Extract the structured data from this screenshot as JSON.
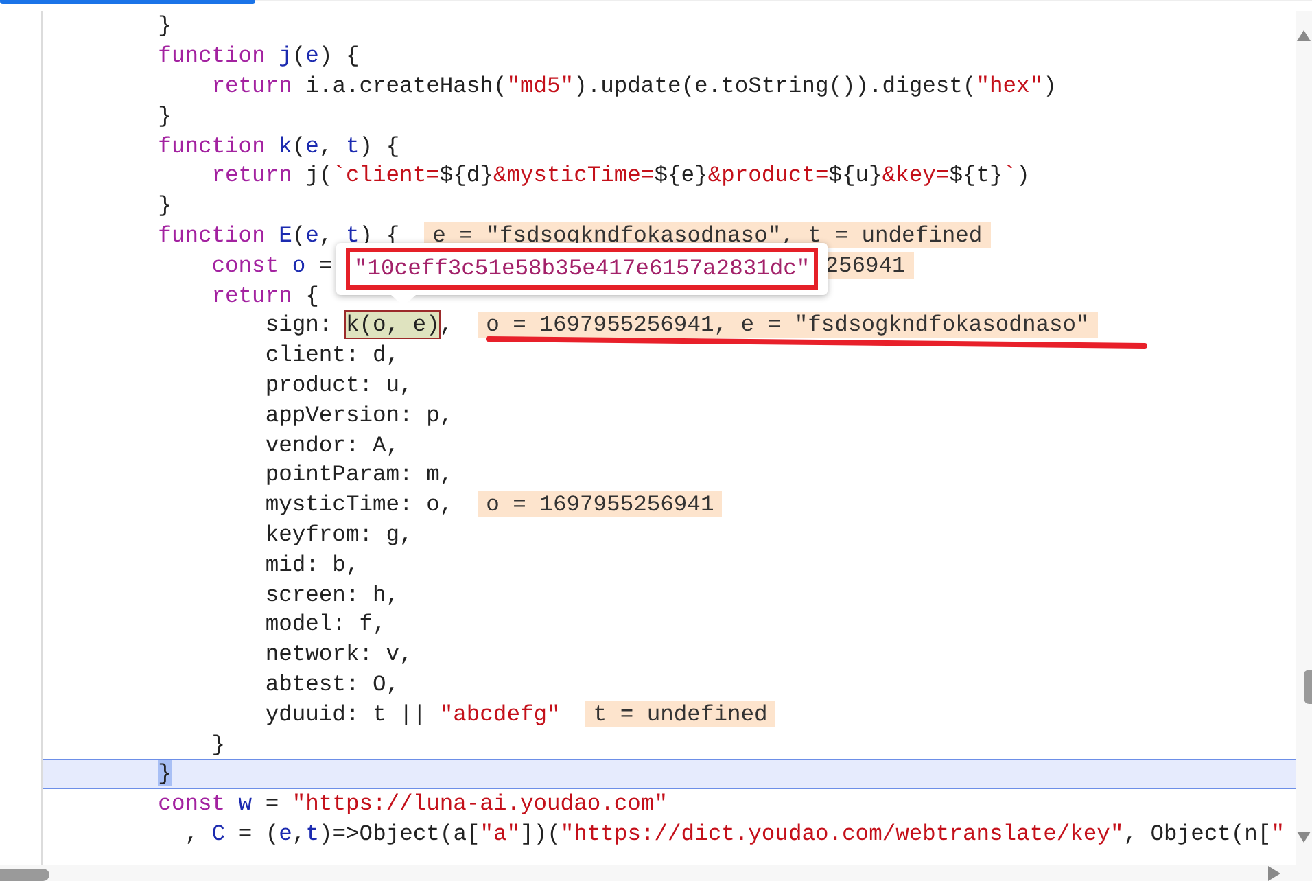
{
  "editor": {
    "lines": [
      {
        "selected": false,
        "underlined": false,
        "tokens": [
          {
            "text": "        }",
            "kind": "plain"
          }
        ]
      },
      {
        "selected": false,
        "underlined": false,
        "tokens": [
          {
            "text": "        function ",
            "kind": "keyword"
          },
          {
            "text": "j",
            "kind": "def"
          },
          {
            "text": "(",
            "kind": "plain"
          },
          {
            "text": "e",
            "kind": "def"
          },
          {
            "text": ") {",
            "kind": "plain"
          }
        ]
      },
      {
        "selected": false,
        "underlined": false,
        "tokens": [
          {
            "text": "            return ",
            "kind": "keyword"
          },
          {
            "text": "i.a.createHash(",
            "kind": "plain"
          },
          {
            "text": "\"md5\"",
            "kind": "string"
          },
          {
            "text": ").update(e.toString()).digest(",
            "kind": "plain"
          },
          {
            "text": "\"hex\"",
            "kind": "string"
          },
          {
            "text": ")",
            "kind": "plain"
          }
        ]
      },
      {
        "selected": false,
        "underlined": false,
        "tokens": [
          {
            "text": "        }",
            "kind": "plain"
          }
        ]
      },
      {
        "selected": false,
        "underlined": false,
        "tokens": [
          {
            "text": "        function ",
            "kind": "keyword"
          },
          {
            "text": "k",
            "kind": "def"
          },
          {
            "text": "(",
            "kind": "plain"
          },
          {
            "text": "e",
            "kind": "def"
          },
          {
            "text": ", ",
            "kind": "plain"
          },
          {
            "text": "t",
            "kind": "def"
          },
          {
            "text": ") {",
            "kind": "plain"
          }
        ]
      },
      {
        "selected": false,
        "underlined": false,
        "tokens": [
          {
            "text": "            return ",
            "kind": "keyword"
          },
          {
            "text": "j(",
            "kind": "plain"
          },
          {
            "text": "`client=",
            "kind": "string"
          },
          {
            "text": "${d}",
            "kind": "plain"
          },
          {
            "text": "&mysticTime=",
            "kind": "string"
          },
          {
            "text": "${e}",
            "kind": "plain"
          },
          {
            "text": "&product=",
            "kind": "string"
          },
          {
            "text": "${u}",
            "kind": "plain"
          },
          {
            "text": "&key=",
            "kind": "string"
          },
          {
            "text": "${t}",
            "kind": "plain"
          },
          {
            "text": "`",
            "kind": "string"
          },
          {
            "text": ")",
            "kind": "plain"
          }
        ]
      },
      {
        "selected": false,
        "underlined": false,
        "tokens": [
          {
            "text": "        }",
            "kind": "plain"
          }
        ]
      },
      {
        "selected": false,
        "underlined": false,
        "tokens": [
          {
            "text": "        function ",
            "kind": "keyword"
          },
          {
            "text": "E",
            "kind": "def"
          },
          {
            "text": "(",
            "kind": "plain"
          },
          {
            "text": "e",
            "kind": "def"
          },
          {
            "text": ", ",
            "kind": "plain"
          },
          {
            "text": "t",
            "kind": "def"
          },
          {
            "text": ") {",
            "kind": "plain"
          }
        ],
        "inline_value": "e = \"fsdsogkndfokasodnaso\", t = undefined"
      },
      {
        "selected": false,
        "underlined": false,
        "tokens": [
          {
            "text": "            const ",
            "kind": "keyword"
          },
          {
            "text": "o",
            "kind": "def"
          },
          {
            "text": " =",
            "kind": "plain"
          }
        ],
        "popover": {
          "value": "\"10ceff3c51e58b35e417e6157a2831dc\""
        },
        "inline_value": "256941"
      },
      {
        "selected": false,
        "underlined": false,
        "tokens": [
          {
            "text": "            return ",
            "kind": "keyword"
          },
          {
            "text": "{",
            "kind": "plain"
          }
        ]
      },
      {
        "selected": false,
        "underlined": true,
        "tokens": [
          {
            "text": "                sign: ",
            "kind": "plain"
          },
          {
            "text": "k(o, e)",
            "kind": "hover"
          },
          {
            "text": ",",
            "kind": "plain"
          }
        ],
        "inline_value": "o = 1697955256941, e = \"fsdsogkndfokasodnaso\""
      },
      {
        "selected": false,
        "underlined": false,
        "tokens": [
          {
            "text": "                client: d,",
            "kind": "plain"
          }
        ]
      },
      {
        "selected": false,
        "underlined": false,
        "tokens": [
          {
            "text": "                product: u,",
            "kind": "plain"
          }
        ]
      },
      {
        "selected": false,
        "underlined": false,
        "tokens": [
          {
            "text": "                appVersion: p,",
            "kind": "plain"
          }
        ]
      },
      {
        "selected": false,
        "underlined": false,
        "tokens": [
          {
            "text": "                vendor: A,",
            "kind": "plain"
          }
        ]
      },
      {
        "selected": false,
        "underlined": false,
        "tokens": [
          {
            "text": "                pointParam: m,",
            "kind": "plain"
          }
        ]
      },
      {
        "selected": false,
        "underlined": false,
        "tokens": [
          {
            "text": "                mysticTime: o,",
            "kind": "plain"
          }
        ],
        "inline_value": "o = 1697955256941"
      },
      {
        "selected": false,
        "underlined": false,
        "tokens": [
          {
            "text": "                keyfrom: g,",
            "kind": "plain"
          }
        ]
      },
      {
        "selected": false,
        "underlined": false,
        "tokens": [
          {
            "text": "                mid: b,",
            "kind": "plain"
          }
        ]
      },
      {
        "selected": false,
        "underlined": false,
        "tokens": [
          {
            "text": "                screen: h,",
            "kind": "plain"
          }
        ]
      },
      {
        "selected": false,
        "underlined": false,
        "tokens": [
          {
            "text": "                model: f,",
            "kind": "plain"
          }
        ]
      },
      {
        "selected": false,
        "underlined": false,
        "tokens": [
          {
            "text": "                network: v,",
            "kind": "plain"
          }
        ]
      },
      {
        "selected": false,
        "underlined": false,
        "tokens": [
          {
            "text": "                abtest: O,",
            "kind": "plain"
          }
        ]
      },
      {
        "selected": false,
        "underlined": false,
        "tokens": [
          {
            "text": "                yduuid: t || ",
            "kind": "plain"
          },
          {
            "text": "\"abcdefg\"",
            "kind": "string"
          }
        ],
        "inline_value": "t = undefined"
      },
      {
        "selected": false,
        "underlined": false,
        "tokens": [
          {
            "text": "            }",
            "kind": "plain"
          }
        ]
      },
      {
        "selected": true,
        "underlined": false,
        "tokens": [
          {
            "text": "        }",
            "kind": "plain"
          }
        ]
      },
      {
        "selected": false,
        "underlined": false,
        "tokens": [
          {
            "text": "        const ",
            "kind": "keyword"
          },
          {
            "text": "w",
            "kind": "def"
          },
          {
            "text": " = ",
            "kind": "plain"
          },
          {
            "text": "\"https://luna-ai.youdao.com\"",
            "kind": "string"
          }
        ]
      },
      {
        "selected": false,
        "underlined": false,
        "tokens": [
          {
            "text": "          , ",
            "kind": "plain"
          },
          {
            "text": "C",
            "kind": "def"
          },
          {
            "text": " = (",
            "kind": "plain"
          },
          {
            "text": "e",
            "kind": "def"
          },
          {
            "text": ",",
            "kind": "plain"
          },
          {
            "text": "t",
            "kind": "def"
          },
          {
            "text": ")=>Object(a[",
            "kind": "plain"
          },
          {
            "text": "\"a\"",
            "kind": "string"
          },
          {
            "text": "])(",
            "kind": "plain"
          },
          {
            "text": "\"https://dict.youdao.com/webtranslate/key\"",
            "kind": "string"
          },
          {
            "text": ", Object(n[",
            "kind": "plain"
          },
          {
            "text": "\"",
            "kind": "string"
          }
        ]
      }
    ]
  }
}
